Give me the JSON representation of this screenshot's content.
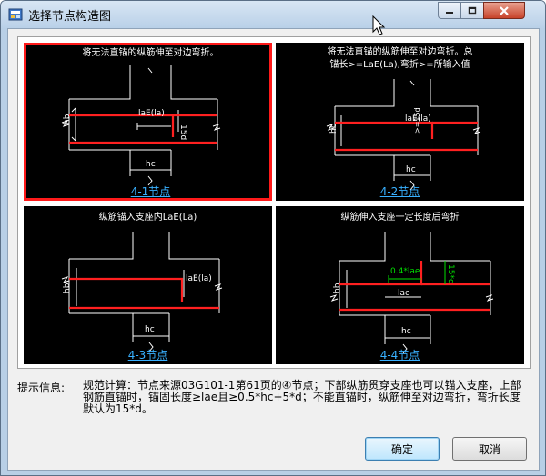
{
  "window": {
    "title": "选择节点构造图"
  },
  "panels": [
    {
      "id": "4-1",
      "title_lines": [
        "将无法直锚的纵筋伸至对边弯折。"
      ],
      "label": "4-1节点",
      "selected": true,
      "annotations": {
        "lae": "laE(la)",
        "d15": "15d",
        "hb": "hb",
        "hc": "hc"
      }
    },
    {
      "id": "4-2",
      "title_lines": [
        "将无法直锚的纵筋伸至对边弯折。总",
        "锚长>=LaE(La),弯折>=所输入值"
      ],
      "label": "4-2节点",
      "selected": false,
      "annotations": {
        "lae": "laE(la)",
        "d15": ">=15d",
        "hb": "hb",
        "hc": "hc"
      }
    },
    {
      "id": "4-3",
      "title_lines": [
        "纵筋锚入支座内LaE(La)"
      ],
      "label": "4-3节点",
      "selected": false,
      "annotations": {
        "lae": "laE(la)",
        "hb": "hb",
        "hc": "hc"
      }
    },
    {
      "id": "4-4",
      "title_lines": [
        "纵筋伸入支座一定长度后弯折"
      ],
      "label": "4-4节点",
      "selected": false,
      "annotations": {
        "lae": "lae",
        "d04": "0.4*lae",
        "d15": "15*d",
        "hb": "hb",
        "hc": "hc"
      }
    }
  ],
  "hint": {
    "label": "提示信息:",
    "text": "规范计算：节点来源03G101-1第61页的④节点；下部纵筋贯穿支座也可以锚入支座，上部钢筋直锚时，锚固长度≥lae且≥0.5*hc+5*d；不能直锚时，纵筋伸至对边弯折，弯折长度默认为15*d。"
  },
  "buttons": {
    "ok": "确定",
    "cancel": "取消"
  },
  "colors": {
    "panel_bg": "#000000",
    "selected_border": "#ff1a1a",
    "rebar": "#ff2020",
    "annotation": "#00e000",
    "link": "#38b0ff"
  }
}
